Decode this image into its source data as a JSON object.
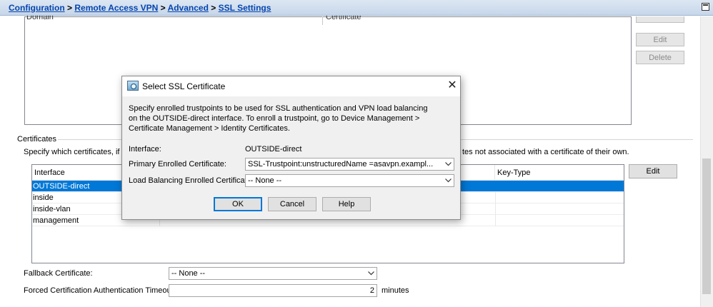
{
  "breadcrumb": {
    "configuration": "Configuration",
    "remote_access_vpn": "Remote Access VPN",
    "advanced": "Advanced",
    "ssl_settings": "SSL Settings",
    "separator": ">"
  },
  "domain_table": {
    "columns": [
      "Domain",
      "Certificate"
    ]
  },
  "domain_buttons": {
    "edit": "Edit",
    "delete": "Delete"
  },
  "certificates": {
    "group_label": "Certificates",
    "description_start": "Specify which certificates, if ar",
    "description_end": "tes not associated with a certificate of their own.",
    "columns": [
      "Interface",
      "Key-Type"
    ],
    "rows": [
      {
        "interface": "OUTSIDE-direct",
        "selected": true
      },
      {
        "interface": "inside",
        "selected": false
      },
      {
        "interface": "inside-vlan",
        "selected": false
      },
      {
        "interface": "management",
        "selected": false
      }
    ],
    "edit_button": "Edit"
  },
  "fallback": {
    "label": "Fallback Certificate:",
    "value": "-- None --"
  },
  "timeout": {
    "label": "Forced Certification Authentication Timeout:",
    "value": "2",
    "unit": "minutes"
  },
  "dialog": {
    "title": "Select SSL Certificate",
    "description": "Specify enrolled trustpoints to be used for SSL authentication and VPN load balancing on the OUTSIDE-direct interface. To enroll a trustpoint, go to Device Management > Certificate Management > Identity Certificates.",
    "interface_label": "Interface:",
    "interface_value": "OUTSIDE-direct",
    "primary_label": "Primary Enrolled Certificate:",
    "primary_value": "SSL-Trustpoint:unstructuredName =asavpn.exampl...",
    "lb_label": "Load Balancing Enrolled Certificate:",
    "lb_value": "-- None --",
    "ok": "OK",
    "cancel": "Cancel",
    "help": "Help",
    "close_glyph": "✕"
  },
  "icons": {
    "dropdown": "chevron-down-icon",
    "dialog_app": "asdm-app-icon",
    "close": "close-icon"
  },
  "colors": {
    "selection": "#0078d7",
    "link": "#0645ad"
  }
}
